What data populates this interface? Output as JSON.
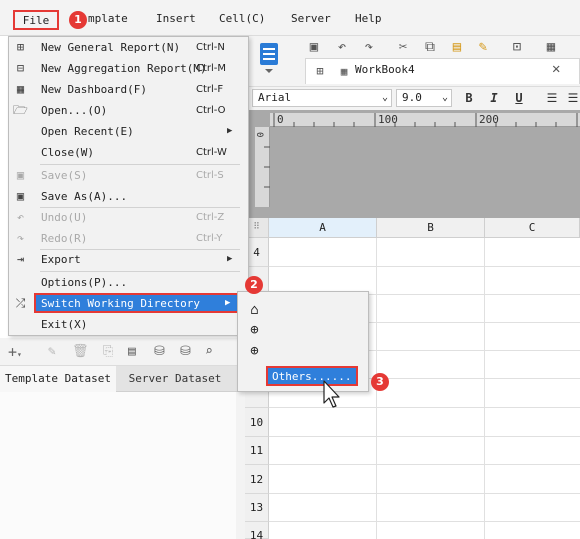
{
  "menubar": {
    "file": "File",
    "template": "mplate",
    "insert": "Insert",
    "cell": "Cell(C)",
    "server": "Server",
    "help": "Help"
  },
  "file_menu": {
    "items": [
      {
        "label": "New General Report(N)",
        "shortcut": "Ctrl-N",
        "icon": "grid-report-icon"
      },
      {
        "label": "New Aggregation Report(M)",
        "shortcut": "Ctrl-M",
        "icon": "aggregation-report-icon"
      },
      {
        "label": "New Dashboard(F)",
        "shortcut": "Ctrl-F",
        "icon": "dashboard-icon"
      },
      {
        "label": "Open...(O)",
        "shortcut": "Ctrl-O",
        "icon": "folder-open-icon"
      },
      {
        "label": "Open Recent(E)",
        "shortcut": "",
        "icon": ""
      },
      {
        "label": "Close(W)",
        "shortcut": "Ctrl-W",
        "icon": ""
      },
      {
        "label": "Save(S)",
        "shortcut": "Ctrl-S",
        "icon": "save-icon",
        "disabled": true
      },
      {
        "label": "Save As(A)...",
        "shortcut": "",
        "icon": "save-as-icon"
      },
      {
        "label": "Undo(U)",
        "shortcut": "Ctrl-Z",
        "icon": "undo-icon",
        "disabled": true
      },
      {
        "label": "Redo(R)",
        "shortcut": "Ctrl-Y",
        "icon": "redo-icon",
        "disabled": true
      },
      {
        "label": "Export",
        "shortcut": "",
        "icon": "export-icon"
      },
      {
        "label": "Options(P)...",
        "shortcut": "",
        "icon": ""
      },
      {
        "label": "Switch Working Directory",
        "shortcut": "",
        "icon": "shuffle-icon"
      },
      {
        "label": "Exit(X)",
        "shortcut": "",
        "icon": ""
      }
    ]
  },
  "submenu": {
    "others": "Others......"
  },
  "toolbar": {
    "sheet_tab": "WorkBook4",
    "font_name": "Arial",
    "font_size": "9.0",
    "bold": "B",
    "italic": "I",
    "underline": "U"
  },
  "ruler": {
    "labels": [
      "0",
      "100",
      "200"
    ]
  },
  "grid": {
    "columns": [
      "A",
      "B",
      "C"
    ],
    "rows": [
      "4",
      "",
      "",
      "",
      "",
      "",
      "10",
      "11",
      "12",
      "13",
      "14"
    ]
  },
  "left_panel": {
    "tab_template": "Template Dataset",
    "tab_server": "Server Dataset"
  },
  "badges": [
    "1",
    "2",
    "3"
  ],
  "colors": {
    "highlight": "#2f7fdb",
    "annotation": "#e53935"
  }
}
